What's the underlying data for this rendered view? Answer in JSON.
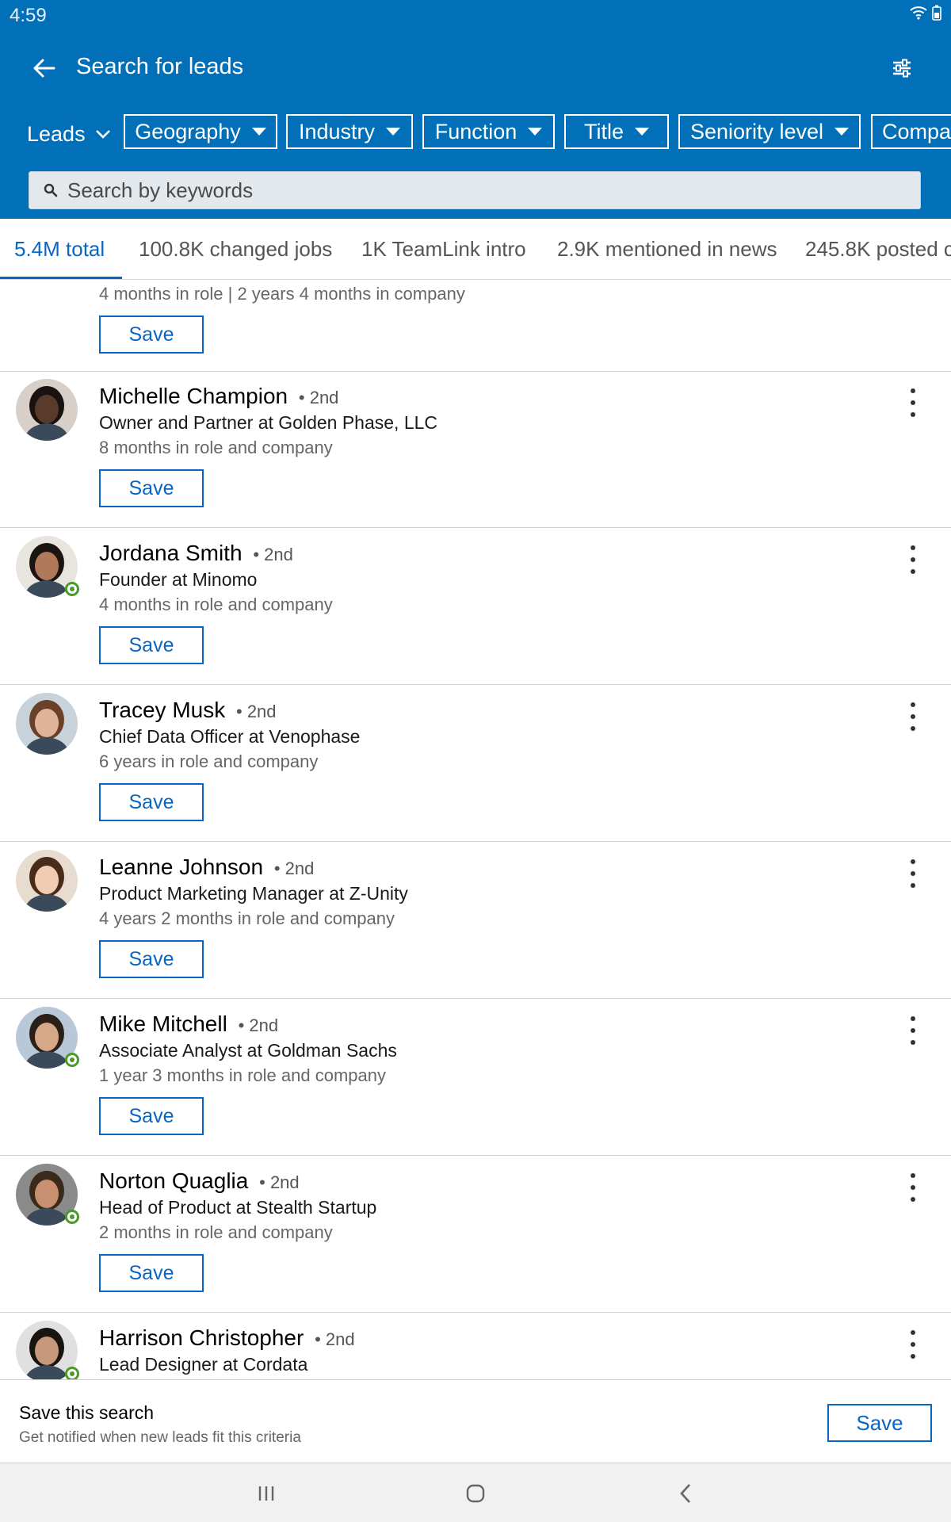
{
  "status_bar": {
    "time": "4:59"
  },
  "header": {
    "title": "Search for leads"
  },
  "filters": {
    "leads_label": "Leads",
    "chips": [
      "Geography",
      "Industry",
      "Function",
      "Title",
      "Seniority level",
      "Compa"
    ]
  },
  "search": {
    "placeholder": "Search by keywords",
    "value": ""
  },
  "tabs": [
    "5.4M total",
    "100.8K changed jobs",
    "1K TeamLink intro",
    "2.9K mentioned in news",
    "245.8K posted c"
  ],
  "partial_top": {
    "tenure": "4 months in role | 2 years 4 months in company",
    "save_label": "Save"
  },
  "leads": [
    {
      "name": "Michelle Champion",
      "degree": "• 2nd",
      "title": "Owner and Partner at Golden Phase, LLC",
      "tenure": "8 months in role and company",
      "save_label": "Save",
      "online": false,
      "skin": "#5a3a2a",
      "hair": "#1a1210",
      "bg": "#d8d0c8"
    },
    {
      "name": "Jordana Smith",
      "degree": "• 2nd",
      "title": "Founder at Minomo",
      "tenure": "4 months in role and company",
      "save_label": "Save",
      "online": true,
      "skin": "#b07a5a",
      "hair": "#1c1410",
      "bg": "#e8e4de"
    },
    {
      "name": "Tracey Musk",
      "degree": "• 2nd",
      "title": "Chief Data Officer at Venophase",
      "tenure": "6 years in role and company",
      "save_label": "Save",
      "online": false,
      "skin": "#e0b49a",
      "hair": "#6a4028",
      "bg": "#c8d2da"
    },
    {
      "name": "Leanne Johnson",
      "degree": "• 2nd",
      "title": "Product Marketing Manager at Z-Unity",
      "tenure": "4 years 2 months in role and company",
      "save_label": "Save",
      "online": false,
      "skin": "#f0cdb2",
      "hair": "#4a2a18",
      "bg": "#e8dcd0"
    },
    {
      "name": "Mike Mitchell",
      "degree": "• 2nd",
      "title": "Associate Analyst at Goldman Sachs",
      "tenure": "1 year 3 months in role and company",
      "save_label": "Save",
      "online": true,
      "skin": "#d6a888",
      "hair": "#2a2018",
      "bg": "#b8c8d8"
    },
    {
      "name": "Norton Quaglia",
      "degree": "• 2nd",
      "title": "Head of Product at Stealth Startup",
      "tenure": "2 months in role and company",
      "save_label": "Save",
      "online": true,
      "skin": "#c89070",
      "hair": "#3a2a1c",
      "bg": "#8a8a8a"
    },
    {
      "name": "Harrison Christopher",
      "degree": "• 2nd",
      "title": "Lead Designer at Cordata",
      "tenure": "",
      "save_label": "Save",
      "online": true,
      "skin": "#c8987a",
      "hair": "#181410",
      "bg": "#e0e0e0"
    }
  ],
  "save_search": {
    "title": "Save this search",
    "subtitle": "Get notified when new leads fit this criteria",
    "button": "Save"
  },
  "colors": {
    "header": "#0270b8",
    "accent": "#0a66c2",
    "online": "#4a9b2a"
  }
}
